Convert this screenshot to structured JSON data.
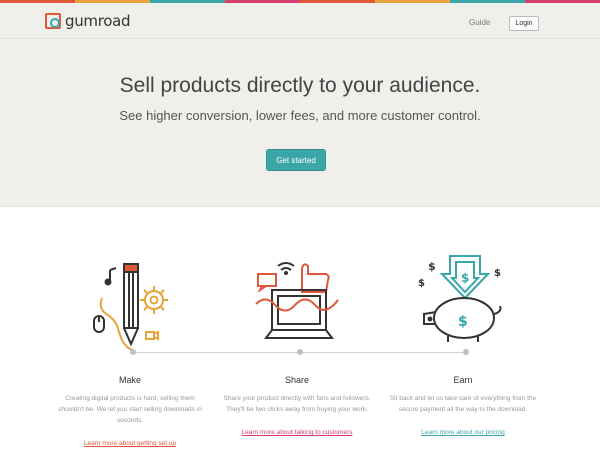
{
  "colors": {
    "accent": "#3aa6a8",
    "orange": "#e8a33d",
    "red": "#e0573a",
    "pink": "#d6406f",
    "stripe": [
      "#e0573a",
      "#e8a33d",
      "#3aa6a8",
      "#d6406f",
      "#e0573a",
      "#e8a33d"
    ]
  },
  "header": {
    "logo_text": "gumroad",
    "guide_label": "Guide",
    "login_label": "Login"
  },
  "hero": {
    "headline": "Sell products directly to your audience.",
    "subline": "See higher conversion, lower fees, and more customer control.",
    "cta_label": "Get started"
  },
  "features": [
    {
      "title": "Make",
      "description": "Creating digital products is hard, selling them shouldn't be. We let you start selling downloads in seconds.",
      "link": "Learn more about getting set up",
      "link_color": "#e0573a"
    },
    {
      "title": "Share",
      "description": "Share your product directly with fans and followers. They'll be two clicks away from buying your work.",
      "link": "Learn more about talking to customers",
      "link_color": "#d6406f"
    },
    {
      "title": "Earn",
      "description": "Sit back and let us take care of everything from the secure payment all the way to the download.",
      "link": "Learn more about our pricing",
      "link_color": "#3aa6a8"
    }
  ]
}
